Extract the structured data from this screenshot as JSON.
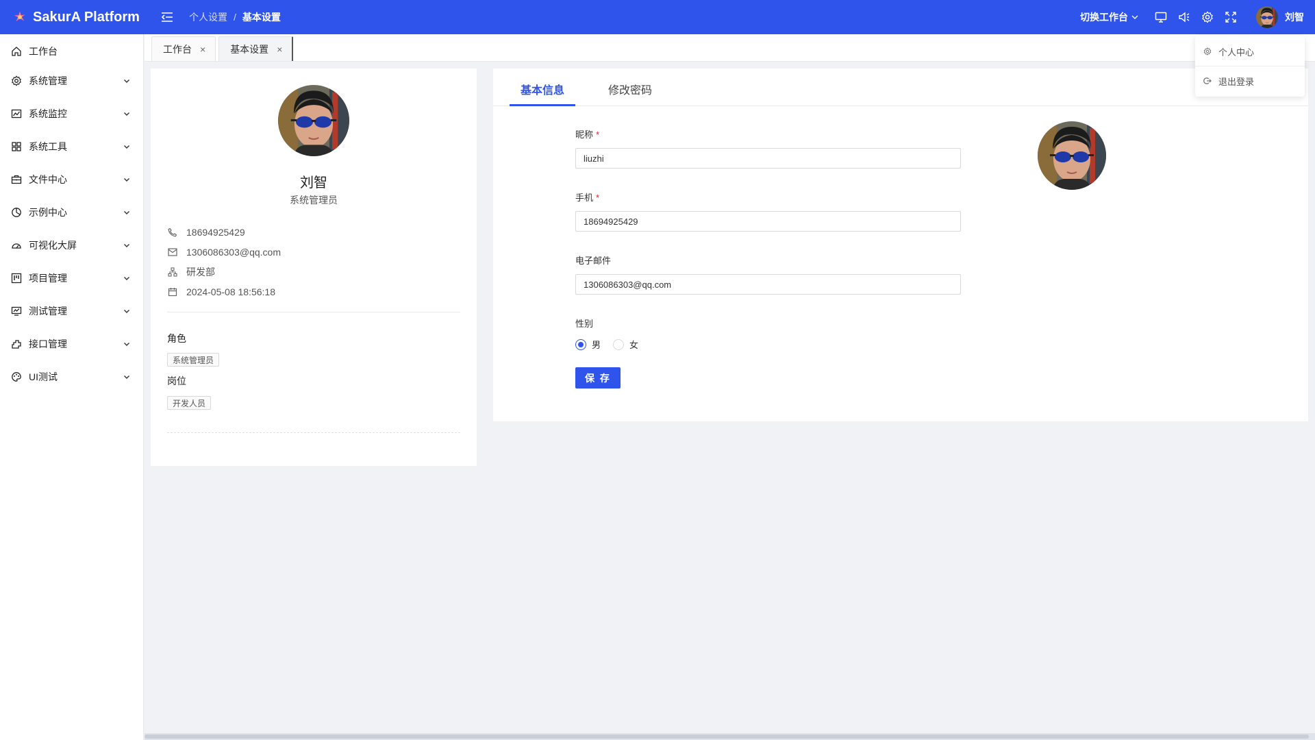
{
  "app": {
    "title": "SakurA Platform"
  },
  "breadcrumb": {
    "parent": "个人设置",
    "separator": "/",
    "current": "基本设置"
  },
  "header": {
    "switch_workspace": "切换工作台",
    "user_name": "刘智",
    "icons": [
      "monitor-icon",
      "sound-icon",
      "gear-icon",
      "fullscreen-icon"
    ]
  },
  "colors": {
    "primary": "#2f54eb",
    "required": "#f5222d"
  },
  "sidebar": {
    "items": [
      {
        "label": "工作台",
        "icon": "home-icon"
      },
      {
        "label": "系统管理",
        "icon": "gear-icon"
      },
      {
        "label": "系统监控",
        "icon": "chart-line-icon"
      },
      {
        "label": "系统工具",
        "icon": "grid-icon"
      },
      {
        "label": "文件中心",
        "icon": "briefcase-icon"
      },
      {
        "label": "示例中心",
        "icon": "pie-icon"
      },
      {
        "label": "可视化大屏",
        "icon": "dashboard-icon"
      },
      {
        "label": "项目管理",
        "icon": "project-icon"
      },
      {
        "label": "测试管理",
        "icon": "fund-icon"
      },
      {
        "label": "接口管理",
        "icon": "api-icon"
      },
      {
        "label": "UI测试",
        "icon": "palette-icon"
      }
    ]
  },
  "tabs": [
    {
      "label": "工作台",
      "close": "×"
    },
    {
      "label": "基本设置",
      "close": "×"
    }
  ],
  "user_menu": {
    "profile": "个人中心",
    "logout": "退出登录"
  },
  "profile": {
    "name": "刘智",
    "role": "系统管理员",
    "phone": "18694925429",
    "email": "1306086303@qq.com",
    "department": "研发部",
    "created_at": "2024-05-08 18:56:18",
    "roles_title": "角色",
    "roles": [
      "系统管理员"
    ],
    "posts_title": "岗位",
    "posts": [
      "开发人员"
    ]
  },
  "form": {
    "tabs": {
      "basic": "基本信息",
      "password": "修改密码"
    },
    "nickname": {
      "label": "昵称",
      "value": "liuzhi",
      "required": "*"
    },
    "phone": {
      "label": "手机",
      "value": "18694925429",
      "required": "*"
    },
    "email": {
      "label": "电子邮件",
      "value": "1306086303@qq.com"
    },
    "gender": {
      "label": "性别",
      "options": [
        "男",
        "女"
      ],
      "selected": "男"
    },
    "save_label": "保 存"
  }
}
